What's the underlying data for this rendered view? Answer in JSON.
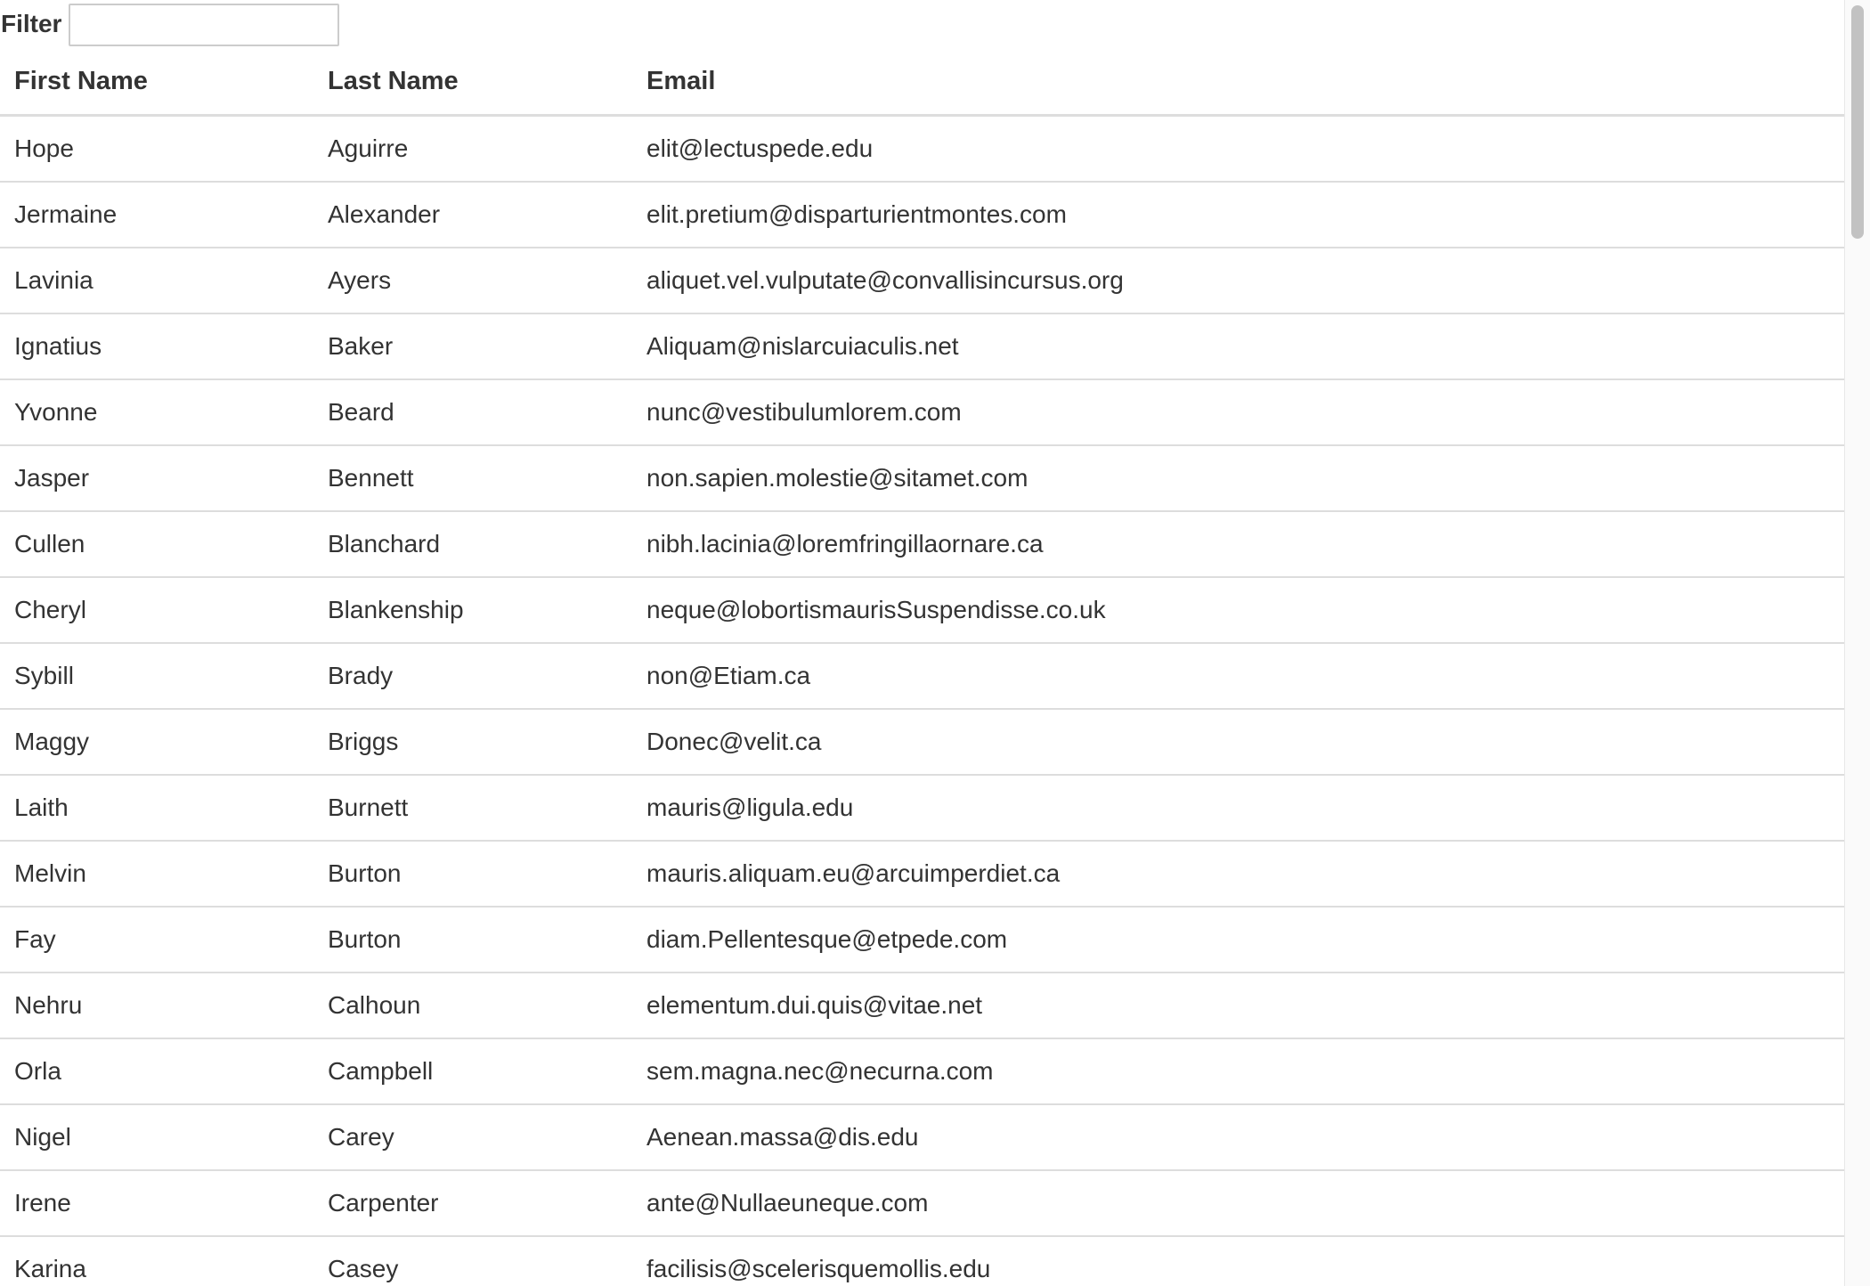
{
  "filter": {
    "label": "Filter",
    "value": "",
    "placeholder": ""
  },
  "table": {
    "columns": [
      "First Name",
      "Last Name",
      "Email"
    ],
    "rows": [
      [
        "Hope",
        "Aguirre",
        "elit@lectuspede.edu"
      ],
      [
        "Jermaine",
        "Alexander",
        "elit.pretium@disparturientmontes.com"
      ],
      [
        "Lavinia",
        "Ayers",
        "aliquet.vel.vulputate@convallisincursus.org"
      ],
      [
        "Ignatius",
        "Baker",
        "Aliquam@nislarcuiaculis.net"
      ],
      [
        "Yvonne",
        "Beard",
        "nunc@vestibulumlorem.com"
      ],
      [
        "Jasper",
        "Bennett",
        "non.sapien.molestie@sitamet.com"
      ],
      [
        "Cullen",
        "Blanchard",
        "nibh.lacinia@loremfringillaornare.ca"
      ],
      [
        "Cheryl",
        "Blankenship",
        "neque@lobortismaurisSuspendisse.co.uk"
      ],
      [
        "Sybill",
        "Brady",
        "non@Etiam.ca"
      ],
      [
        "Maggy",
        "Briggs",
        "Donec@velit.ca"
      ],
      [
        "Laith",
        "Burnett",
        "mauris@ligula.edu"
      ],
      [
        "Melvin",
        "Burton",
        "mauris.aliquam.eu@arcuimperdiet.ca"
      ],
      [
        "Fay",
        "Burton",
        "diam.Pellentesque@etpede.com"
      ],
      [
        "Nehru",
        "Calhoun",
        "elementum.dui.quis@vitae.net"
      ],
      [
        "Orla",
        "Campbell",
        "sem.magna.nec@necurna.com"
      ],
      [
        "Nigel",
        "Carey",
        "Aenean.massa@dis.edu"
      ],
      [
        "Irene",
        "Carpenter",
        "ante@Nullaeuneque.com"
      ],
      [
        "Karina",
        "Casey",
        "facilisis@scelerisquemollis.edu"
      ]
    ]
  },
  "colors": {
    "text": "#333333",
    "border": "#dddddd",
    "input_border": "#cccccc",
    "scroll_thumb": "#c2c2c2"
  }
}
